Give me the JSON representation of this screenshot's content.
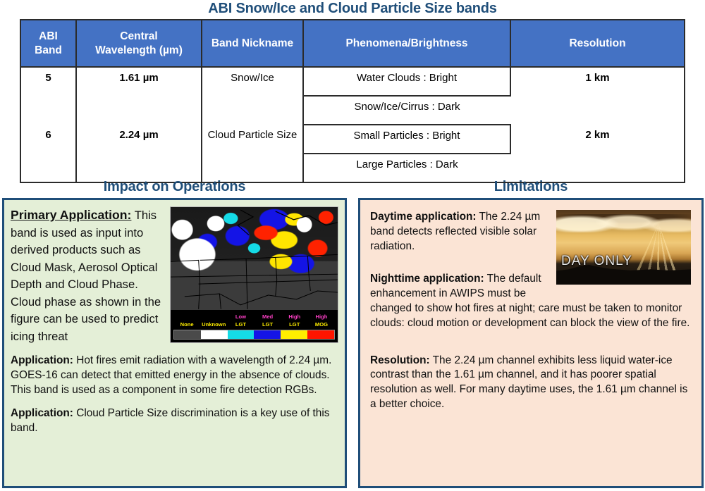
{
  "title": "ABI Snow/Ice and Cloud Particle Size bands",
  "colors": {
    "table_header_blue": "#4472C4",
    "heading_navy": "#1F4E79",
    "left_panel_bg": "#E4EFD7",
    "right_panel_bg": "#FBE4D5",
    "panel_border": "#1F4E79"
  },
  "table": {
    "columns": [
      "ABI Band",
      "Central Wavelength (µm)",
      "Band Nickname",
      "Phenomena/Brightness",
      "Resolution"
    ],
    "column_lines": [
      [
        "ABI",
        "Band"
      ],
      [
        "Central",
        "Wavelength (µm)"
      ],
      [
        "Band Nickname"
      ],
      [
        "Phenomena/Brightness"
      ],
      [
        "Resolution"
      ]
    ],
    "rows": [
      {
        "band": "5",
        "wavelength": "1.61 µm",
        "nickname": "Snow/Ice",
        "phenomena": [
          "Water Clouds : Bright",
          "Snow/Ice/Cirrus : Dark"
        ],
        "resolution": "1 km"
      },
      {
        "band": "6",
        "wavelength": "2.24 µm",
        "nickname": "Cloud Particle Size",
        "phenomena": [
          "Small Particles : Bright",
          "Large Particles : Dark"
        ],
        "resolution": "2 km"
      }
    ]
  },
  "left_panel": {
    "header": "Impact on Operations",
    "blocks": [
      {
        "lead": "Primary Application:",
        "lead_style": "bold-underline",
        "text": " This band is used as input into derived products such as Cloud Mask, Aerosol Optical Depth and Cloud Phase.  Cloud phase as shown in the figure can be used to predict icing threat"
      },
      {
        "lead": "Application:",
        "lead_style": "bold",
        "text": " Hot fires emit radiation with a wavelength of 2.24 µm. GOES-16 can detect that emitted energy in the absence of clouds.  This band is used as a component in some fire detection RGBs."
      },
      {
        "lead": "Application:",
        "lead_style": "bold",
        "text": " Cloud Particle Size discrimination is a key use of this band."
      }
    ],
    "figure": {
      "name": "cloud-phase-satellite-image",
      "legend": [
        {
          "top": "",
          "bottom": "None",
          "color": "#4a4a4a"
        },
        {
          "top": "",
          "bottom": "Unknown",
          "color": "#ffffff"
        },
        {
          "top": "Low",
          "bottom": "LGT",
          "color": "#15dbe6"
        },
        {
          "top": "Med",
          "bottom": "LGT",
          "color": "#1414e6"
        },
        {
          "top": "High",
          "bottom": "LGT",
          "color": "#ffee00"
        },
        {
          "top": "High",
          "bottom": "MOG",
          "color": "#ff1400"
        }
      ]
    }
  },
  "right_panel": {
    "header": "Limitations",
    "blocks": [
      {
        "lead": "Daytime application:",
        "lead_style": "bold",
        "text": " The 2.24 µm band detects reflected visible solar radiation."
      },
      {
        "lead": "Nighttime application:",
        "lead_style": "bold",
        "text": "  The default enhancement in AWIPS must be changed to show hot fires at night; care must be taken to monitor clouds:  cloud motion or development can block the view of the fire."
      },
      {
        "lead": "Resolution:",
        "lead_style": "bold",
        "text": "  The 2.24 µm channel exhibits less liquid water-ice contrast than the 1.61 µm channel, and it has poorer spatial resolution as well. For many daytime uses, the 1.61 µm channel is a better choice."
      }
    ],
    "figure": {
      "name": "sunset-day-only-photo",
      "caption": "DAY ONLY"
    }
  }
}
